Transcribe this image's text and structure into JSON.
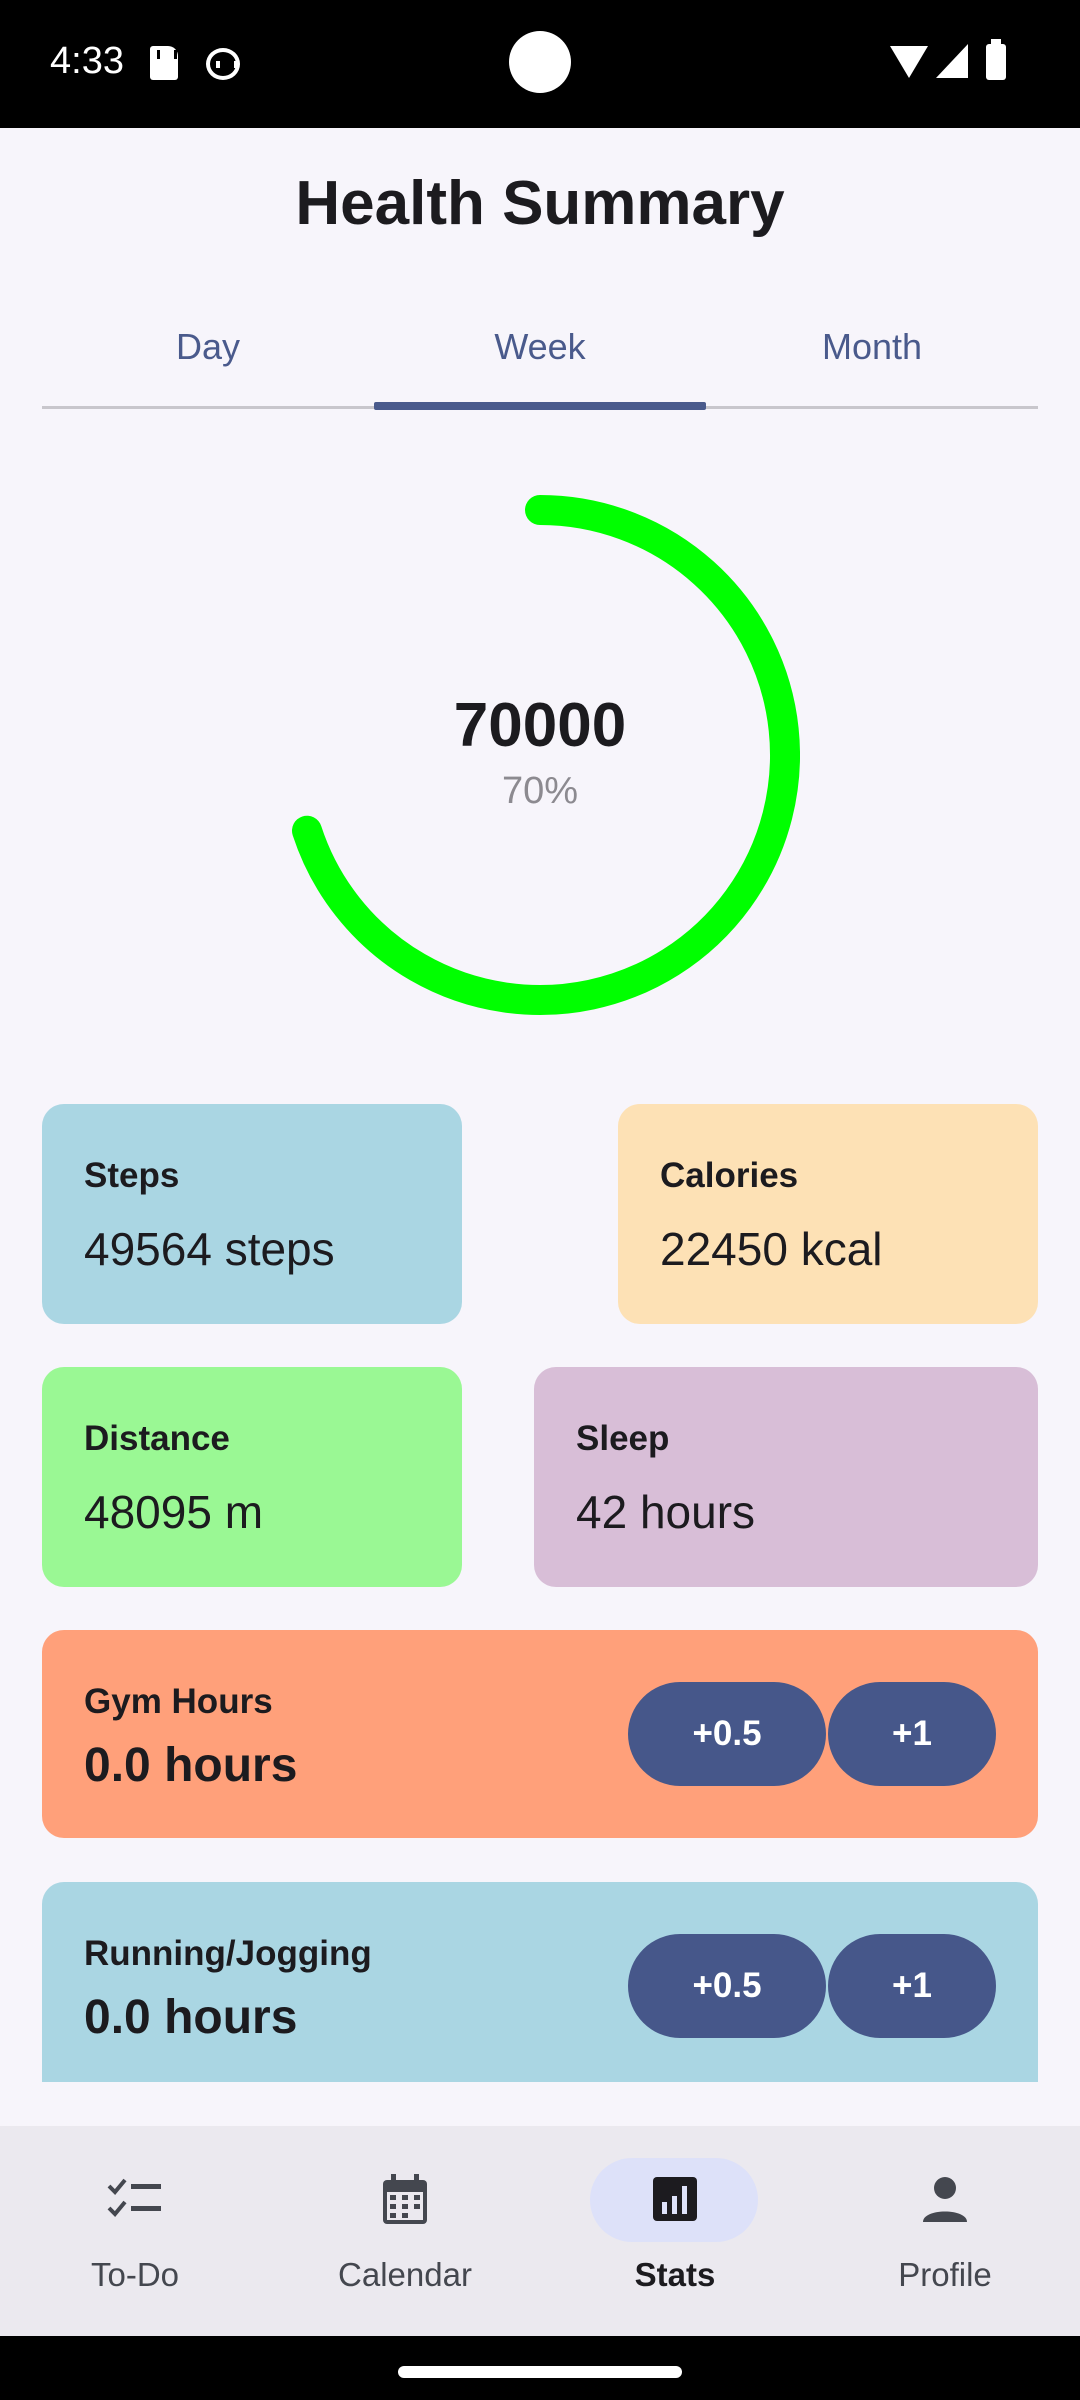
{
  "status_bar": {
    "time": "4:33",
    "icons": [
      "sd-card-icon",
      "cat-face-icon",
      "wifi-icon",
      "signal-icon",
      "battery-icon"
    ]
  },
  "header": {
    "title": "Health Summary"
  },
  "tabs": [
    {
      "label": "Day",
      "selected": false
    },
    {
      "label": "Week",
      "selected": true
    },
    {
      "label": "Month",
      "selected": false
    }
  ],
  "progress_ring": {
    "value": "70000",
    "percent_label": "70%",
    "progress_fraction": 0.7,
    "color": "#00ff00"
  },
  "stats": {
    "steps": {
      "label": "Steps",
      "value": "49564 steps",
      "color": "#aad6e3"
    },
    "calories": {
      "label": "Calories",
      "value": "22450 kcal",
      "color": "#fde1b5"
    },
    "distance": {
      "label": "Distance",
      "value": "48095 m",
      "color": "#9af894"
    },
    "sleep": {
      "label": "Sleep",
      "value": "42 hours",
      "color": "#d8bed7"
    }
  },
  "activities": {
    "gym": {
      "label": "Gym Hours",
      "value": "0.0 hours",
      "add_half": "+0.5",
      "add_one": "+1",
      "color": "#ffa07a"
    },
    "running": {
      "label": "Running/Jogging",
      "value": "0.0 hours",
      "add_half": "+0.5",
      "add_one": "+1",
      "color": "#aad6e3"
    }
  },
  "bottom_nav": [
    {
      "label": "To-Do",
      "icon": "checklist-icon",
      "selected": false
    },
    {
      "label": "Calendar",
      "icon": "calendar-icon",
      "selected": false
    },
    {
      "label": "Stats",
      "icon": "bar-chart-icon",
      "selected": true
    },
    {
      "label": "Profile",
      "icon": "person-icon",
      "selected": false
    }
  ],
  "colors": {
    "accent": "#4a5a8c",
    "button": "#46578a",
    "nav_pill": "#dde1f9"
  }
}
